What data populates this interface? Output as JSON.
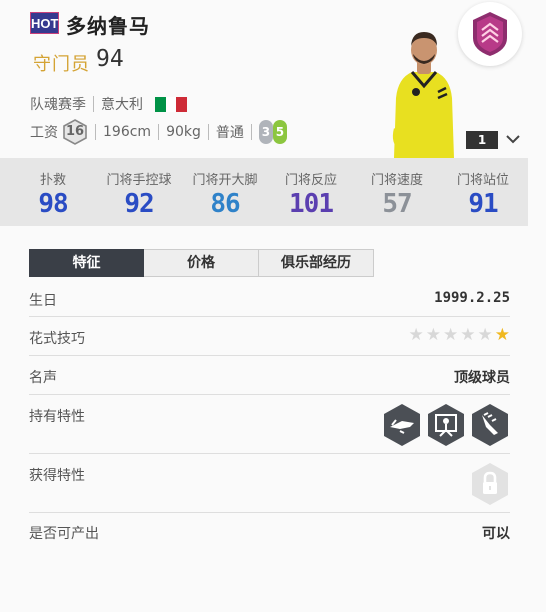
{
  "header": {
    "hot_label": "HOT",
    "player_name": "多纳鲁马",
    "position": "守门员",
    "overall": "94",
    "season": "队魂赛季",
    "nationality": "意大利",
    "flag_colors": [
      "#009246",
      "#ffffff",
      "#ce2b37"
    ],
    "wage_label": "工资",
    "wage": "16",
    "height": "196cm",
    "weight": "90kg",
    "body_type": "普通",
    "weak_foot": "3",
    "skill_moves": "5",
    "level": "1"
  },
  "stats": [
    {
      "label": "扑救",
      "value": "98",
      "color": "#2a4cc4"
    },
    {
      "label": "门将手控球",
      "value": "92",
      "color": "#2a4cc4"
    },
    {
      "label": "门将开大脚",
      "value": "86",
      "color": "#2f82c9"
    },
    {
      "label": "门将反应",
      "value": "101",
      "color": "#5b3fb0"
    },
    {
      "label": "门将速度",
      "value": "57",
      "color": "#8c9198"
    },
    {
      "label": "门将站位",
      "value": "91",
      "color": "#2a4cc4"
    }
  ],
  "tabs": [
    "特征",
    "价格",
    "俱乐部经历"
  ],
  "details": {
    "birthday_label": "生日",
    "birthday": "1999.2.25",
    "skill_label": "花式技巧",
    "skill_stars": 1,
    "fame_label": "名声",
    "fame": "顶级球员",
    "traits_label": "持有特性",
    "acquired_label": "获得特性",
    "producible_label": "是否可产出",
    "producible": "可以"
  },
  "icons": {
    "club": "club-crest-icon",
    "expand": "chevron-down-icon",
    "traits": [
      "glove-trait-icon",
      "goalkeeper-trait-icon",
      "catch-trait-icon"
    ],
    "locked": "lock-icon"
  },
  "colors": {
    "position": "#d4a334",
    "active_tab": "#3a3f47",
    "hot_badge": "#35398f",
    "star_on": "#f0b820",
    "weak_foot_badge": "#b0b4ba",
    "skill_moves_badge": "#8cc63f"
  }
}
